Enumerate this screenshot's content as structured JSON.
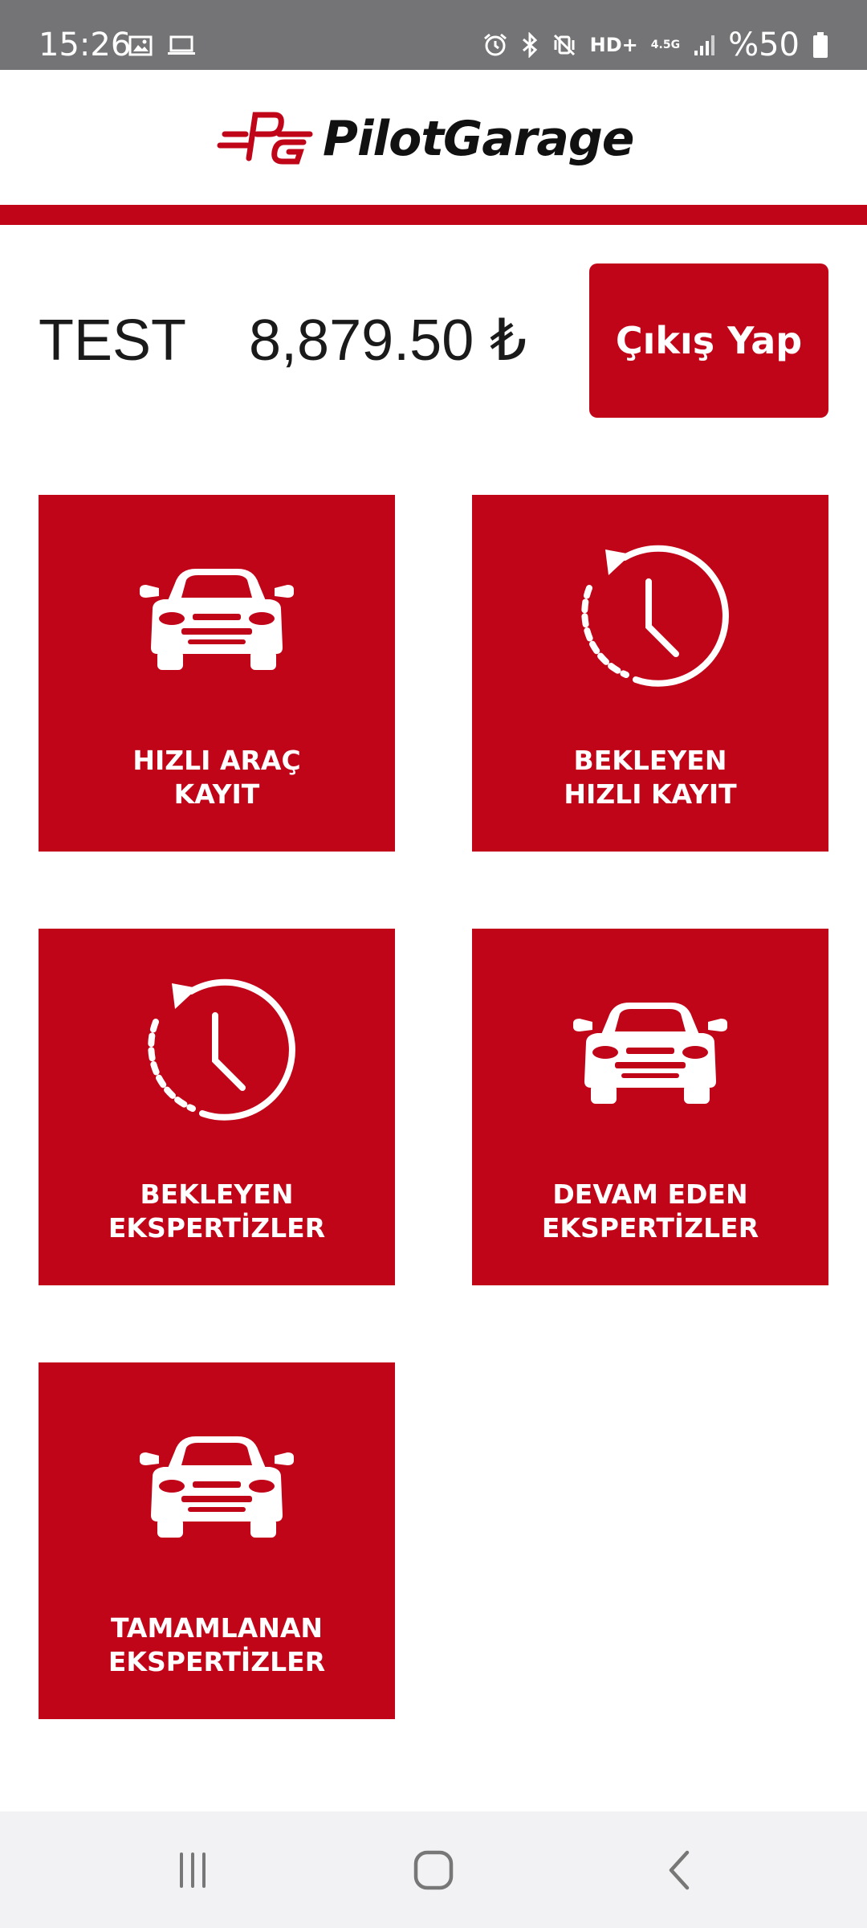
{
  "status_bar": {
    "time": "15:26",
    "left_icons": [
      "image-icon",
      "laptop-icon"
    ],
    "right_icons": [
      "alarm-icon",
      "bluetooth-icon",
      "vibrate-off-icon"
    ],
    "hd_label": "HD+",
    "network_label": "4.5G",
    "battery_text": "%50"
  },
  "header": {
    "logo_text": "PilotGarage",
    "accent_color": "#c10519"
  },
  "account": {
    "name": "TEST",
    "balance": "8,879.50 ₺",
    "logout_label": "Çıkış Yap"
  },
  "tiles": [
    {
      "line1": "HIZLI ARAÇ",
      "line2": "KAYIT",
      "icon": "car-icon"
    },
    {
      "line1": "BEKLEYEN",
      "line2": "HIZLI KAYIT",
      "icon": "clock-history-icon"
    },
    {
      "line1": "BEKLEYEN",
      "line2": "EKSPERTİZLER",
      "icon": "clock-history-icon"
    },
    {
      "line1": "DEVAM EDEN",
      "line2": "EKSPERTİZLER",
      "icon": "car-icon"
    },
    {
      "line1": "TAMAMLANAN",
      "line2": "EKSPERTİZLER",
      "icon": "car-icon"
    }
  ],
  "nav_bar": {
    "buttons": [
      "recent-apps-icon",
      "home-icon",
      "back-icon"
    ]
  }
}
